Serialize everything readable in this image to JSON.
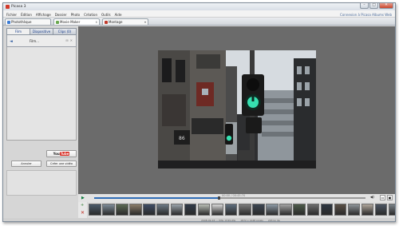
{
  "window": {
    "title": "Picasa 3",
    "buttons": {
      "minimize": "–",
      "maximize": "□",
      "close": "✕"
    }
  },
  "menu": {
    "items": [
      "Fichier",
      "Édition",
      "Affichage",
      "Dossier",
      "Photo",
      "Création",
      "Outils",
      "Aide"
    ],
    "right": [
      "Connexion à Picasa Albums Web"
    ]
  },
  "tabs": [
    {
      "label": "Photothèque",
      "color": "#3a7bd5"
    },
    {
      "label": "Movie Maker",
      "color": "#6aa84f",
      "close": "x"
    },
    {
      "label": "Montage",
      "color": "#c0392b",
      "close": "▾"
    }
  ],
  "left_panel": {
    "tabs": [
      "Film",
      "Diapositive",
      "Clips (0)"
    ],
    "active_tab": 0,
    "back_icon": "◄",
    "item_name": "Film...",
    "icons": [
      "⊞",
      "✕"
    ],
    "youtube": {
      "you": "You",
      "tube": "Tube"
    },
    "buttons": [
      "Annuler",
      "Créer une vidéo"
    ]
  },
  "player": {
    "play_icon": "▶",
    "time": "00:00 / 00:45:70",
    "progress": 0.46,
    "volume_icon": "◀)",
    "view_icons": [
      "▭",
      "▣"
    ]
  },
  "strip_side": {
    "add_icon": "+",
    "delete_icon": "✕"
  },
  "filmstrip": {
    "thumb_colors": [
      "#4a5a6a",
      "#7e8c99",
      "#5c6b55",
      "#8b7d6b",
      "#3f4d66",
      "#6d7a86",
      "#9aa3ab",
      "#2f3a48",
      "#b8bdb5",
      "#d9d9d9",
      "#5e6e7e",
      "#7b7b7b",
      "#3c4652",
      "#8d9aa5",
      "#a5a5a5",
      "#4d5b4a",
      "#6e6e6e",
      "#2c3540",
      "#5a4f46",
      "#8e9499",
      "#b0a79c",
      "#4b5563",
      "#7a8288",
      "#646f5c",
      "#9c9c9c",
      "#3e3e3e",
      "#a15b4e",
      "#c44a3a",
      "#7c2f2a",
      "#5a6672",
      "#88929a",
      "#d2d2d2"
    ]
  },
  "status": {
    "items": [
      "2008-09-16 — IMG_0745.JPG",
      "1872 x 1248 pixels",
      "293 ko de"
    ]
  }
}
